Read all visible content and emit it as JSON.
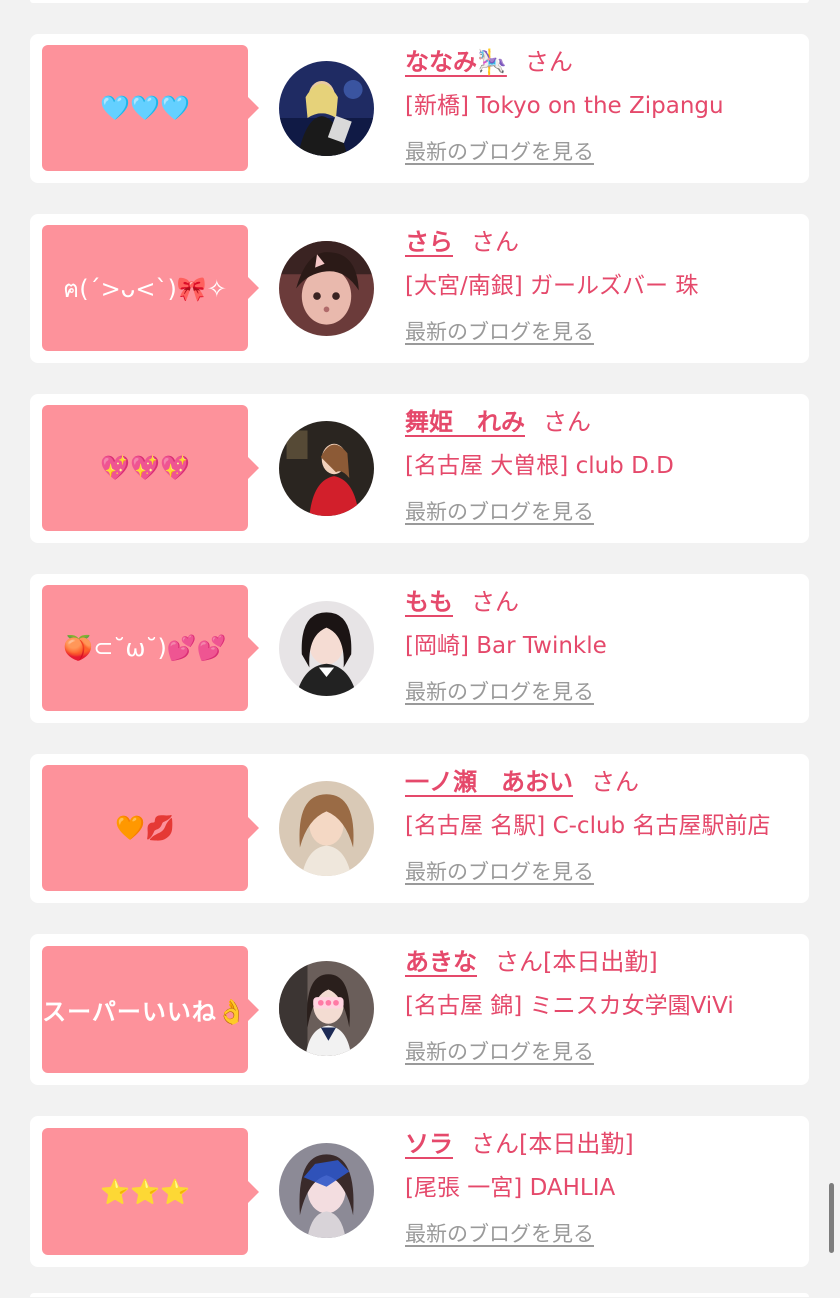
{
  "san_label": "さん",
  "blog_label": "最新のブログを見る",
  "cards": [
    {
      "message": "🩵🩵🩵",
      "name": "ななみ🎠",
      "status": "",
      "shop": "[新橋] Tokyo on the Zipangu"
    },
    {
      "message": "ฅ(ˊ>ᴗ<ˋ)🎀✧",
      "name": "さら",
      "status": "",
      "shop": "[大宮/南銀] ガールズバー 珠"
    },
    {
      "message": "💖💖💖",
      "name": "舞姫　れみ",
      "status": "",
      "shop": "[名古屋 大曽根] club D.D"
    },
    {
      "message": "🍑⊂˘ω˘)💕💕",
      "name": "もも",
      "status": "",
      "shop": "[岡崎] Bar Twinkle"
    },
    {
      "message": "🧡💋",
      "name": "一ノ瀬　あおい",
      "status": "",
      "shop": "[名古屋 名駅] C-club 名古屋駅前店"
    },
    {
      "message": "スーパーいいね👌",
      "name": "あきな",
      "status": "[本日出勤]",
      "shop": "[名古屋 錦] ミニスカ女学園ViVi"
    },
    {
      "message": "⭐⭐⭐",
      "name": "ソラ",
      "status": "[本日出勤]",
      "shop": "[尾張 一宮] DAHLIA"
    }
  ]
}
